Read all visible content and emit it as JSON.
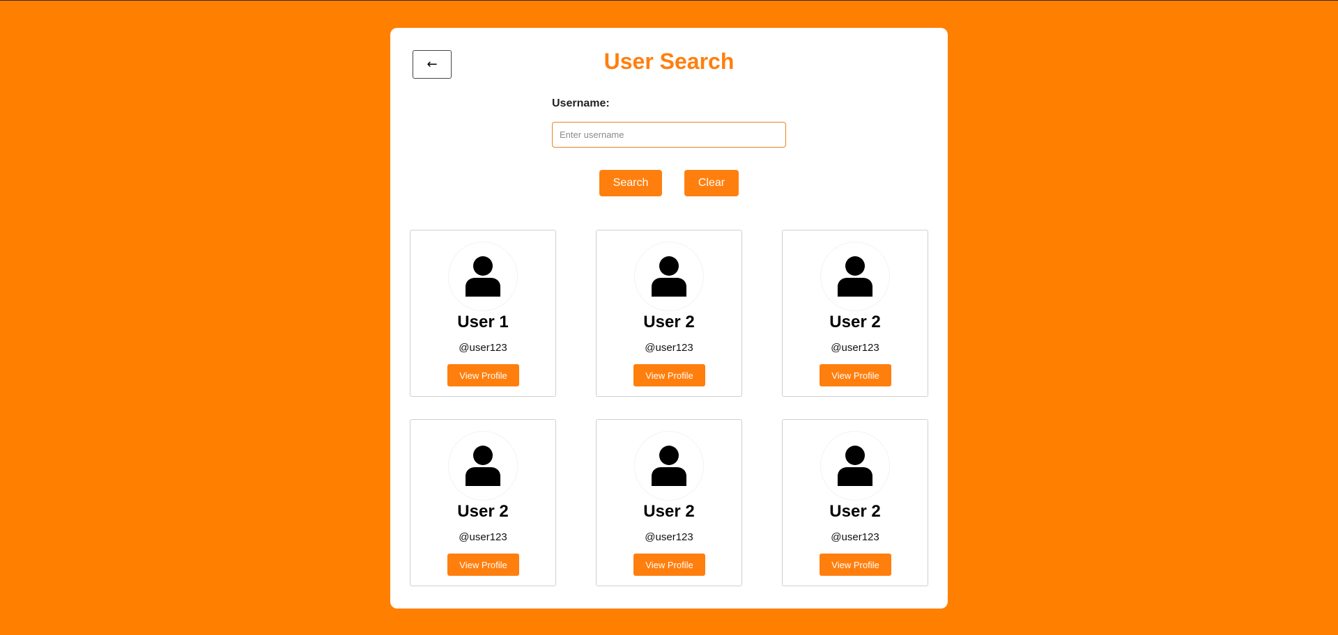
{
  "header": {
    "back_label": "←",
    "title": "User Search"
  },
  "search": {
    "label": "Username:",
    "value": "",
    "placeholder": "Enter username",
    "search_label": "Search",
    "clear_label": "Clear"
  },
  "users": [
    {
      "name": "User 1",
      "handle": "@user123",
      "button": "View Profile"
    },
    {
      "name": "User 2",
      "handle": "@user123",
      "button": "View Profile"
    },
    {
      "name": "User 2",
      "handle": "@user123",
      "button": "View Profile"
    },
    {
      "name": "User 2",
      "handle": "@user123",
      "button": "View Profile"
    },
    {
      "name": "User 2",
      "handle": "@user123",
      "button": "View Profile"
    },
    {
      "name": "User 2",
      "handle": "@user123",
      "button": "View Profile"
    }
  ],
  "colors": {
    "background": "#ff7f00",
    "accent": "#ff7f0e",
    "panel": "#ffffff"
  },
  "icons": {
    "back": "left-arrow-icon",
    "avatar": "user-icon"
  }
}
